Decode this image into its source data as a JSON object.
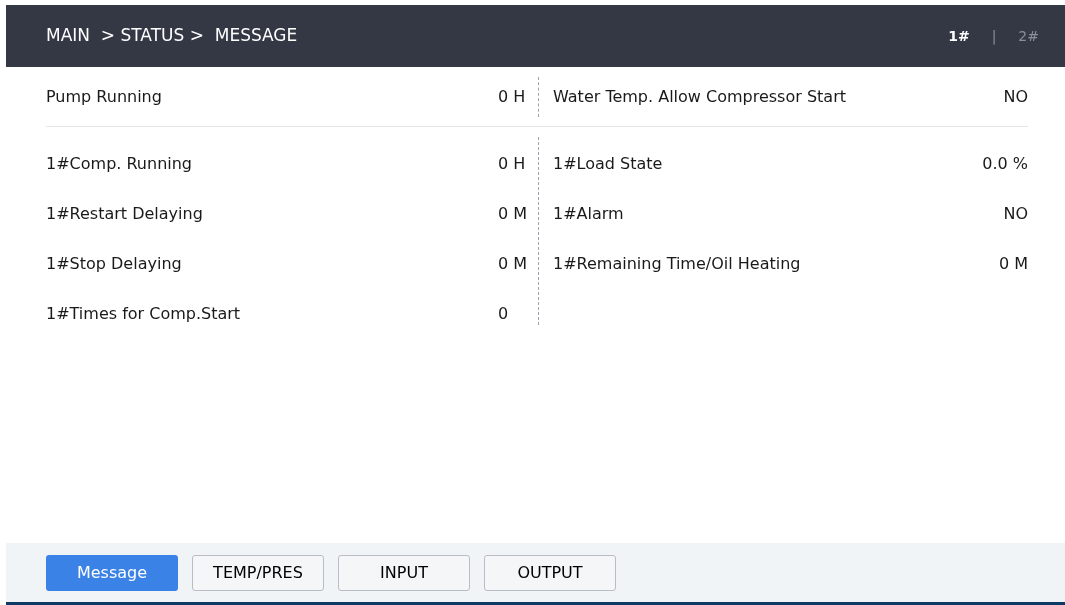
{
  "breadcrumb": "MAIN  > STATUS >  MESSAGE",
  "units": [
    {
      "label": "1#",
      "selected": true
    },
    {
      "label": "2#",
      "selected": false
    }
  ],
  "separator": "|",
  "top_row": {
    "left": {
      "label": "Pump Running",
      "value": "0 H"
    },
    "right": {
      "label": "Water Temp. Allow Compressor Start",
      "value": "NO"
    }
  },
  "left_rows": [
    {
      "label": "1#Comp. Running",
      "value": "0 H"
    },
    {
      "label": "1#Restart Delaying",
      "value": "0 M"
    },
    {
      "label": "1#Stop Delaying",
      "value": "0 M"
    },
    {
      "label": "1#Times for Comp.Start",
      "value": "0"
    }
  ],
  "right_rows": [
    {
      "label": "1#Load State",
      "value": "0.0 %"
    },
    {
      "label": "1#Alarm",
      "value": "NO"
    },
    {
      "label": "1#Remaining Time/Oil Heating",
      "value": "0 M"
    }
  ],
  "tabs": [
    {
      "label": "Message",
      "selected": true
    },
    {
      "label": "TEMP/PRES",
      "selected": false
    },
    {
      "label": "INPUT",
      "selected": false
    },
    {
      "label": "OUTPUT",
      "selected": false
    }
  ]
}
